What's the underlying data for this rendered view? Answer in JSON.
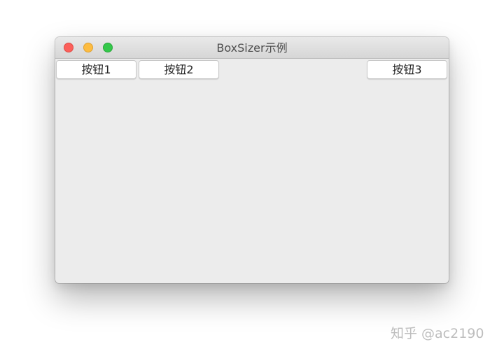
{
  "window": {
    "title": "BoxSizer示例",
    "controls": {
      "close_icon": "close-icon",
      "minimize_icon": "minimize-icon",
      "zoom_icon": "zoom-icon"
    }
  },
  "buttons": [
    {
      "label": "按钮1"
    },
    {
      "label": "按钮2"
    },
    {
      "label": "按钮3"
    }
  ],
  "watermark": {
    "text": "知乎 @ac2190"
  },
  "colors": {
    "close": "#fc605b",
    "minimize": "#fdbc40",
    "zoom": "#34c84a",
    "window_bg": "#ececec"
  }
}
